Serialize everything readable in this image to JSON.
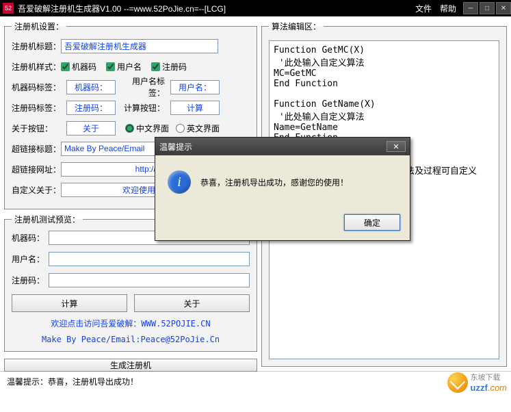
{
  "titlebar": {
    "title": "吾爱破解注册机生成器V1.00  --=www.52PoJie.cn=--[LCG]",
    "menu_file": "文件",
    "menu_help": "帮助"
  },
  "settings": {
    "legend": "注册机设置：",
    "title_label": "注册机标题：",
    "title_value": "吾爱破解注册机生成器",
    "style_label": "注册机样式：",
    "cb_machine": "机器码",
    "cb_user": "用户名",
    "cb_reg": "注册码",
    "mc_tag_label": "机器码标签：",
    "mc_tag_value": "机器码：",
    "user_tag_label": "用户名标签：",
    "user_tag_value": "用户名：",
    "reg_tag_label": "注册码标签：",
    "reg_tag_value": "注册码：",
    "calc_btn_label": "计算按钮：",
    "calc_btn_value": "计算",
    "about_btn_label": "关于按钮：",
    "about_btn_value": "关于",
    "radio_cn": "中文界面",
    "radio_en": "英文界面",
    "link_title_label": "超链接标题：",
    "link_title_value": "Make By Peace/Email",
    "link_url_label": "超链接网址：",
    "link_url_value": "http://www.",
    "custom_about_label": "自定义关于：",
    "custom_about_value": "欢迎使用吾爱破解"
  },
  "test": {
    "legend": "注册机测试预览：",
    "mc_label": "机器码：",
    "user_label": "用户名：",
    "reg_label": "注册码：",
    "calc_btn": "计算",
    "about_btn": "关于",
    "link1": "欢迎点击访问吾爱破解：WWW.52POJIE.CN",
    "link2": "Make By Peace/Email:Peace@52PoJie.Cn"
  },
  "gen_btn": "生成注册机",
  "editor": {
    "legend": "算法编辑区：",
    "code": "Function GetMC(X)\n '此处输入自定义算法\nMC=GetMC\nEnd Function\n\nFunction GetName(X)\n '此处输入自定义算法\nName=GetName\nEnd Function\n\nFunction GetSN()\nGetSN=md5(mc & name)  '算法及过程可自定义"
  },
  "statusbar": "温馨提示：恭喜，注册机导出成功！",
  "dialog": {
    "title": "温馨提示",
    "message": "恭喜，注册机导出成功，感谢您的使用！",
    "ok": "确定"
  },
  "watermark": {
    "text1": "东坡下载",
    "text2": "uzzf",
    "text3": ".com"
  }
}
